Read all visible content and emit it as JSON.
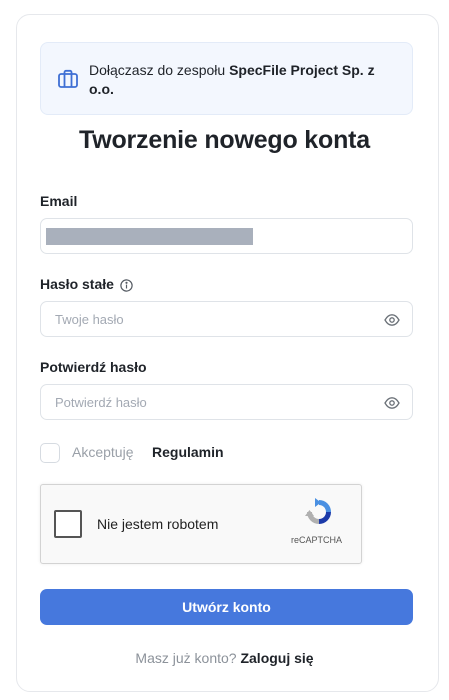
{
  "notice": {
    "text_prefix": "Dołączasz do zespołu ",
    "company": "SpecFile Project Sp. z o.o."
  },
  "title": "Tworzenie nowego konta",
  "email": {
    "label": "Email"
  },
  "password": {
    "label": "Hasło stałe",
    "placeholder": "Twoje hasło"
  },
  "confirm": {
    "label": "Potwierdź hasło",
    "placeholder": "Potwierdź hasło"
  },
  "terms": {
    "text": "Akceptuję",
    "link": "Regulamin",
    "checked": false
  },
  "recaptcha": {
    "label": "Nie jestem robotem",
    "brand": "reCAPTCHA",
    "checked": false
  },
  "submit_label": "Utwórz konto",
  "footer": {
    "question": "Masz już konto?",
    "link": "Zaloguj się"
  },
  "colors": {
    "accent": "#4678dd",
    "notice_bg": "#f3f7fe",
    "text": "#1f2329"
  }
}
